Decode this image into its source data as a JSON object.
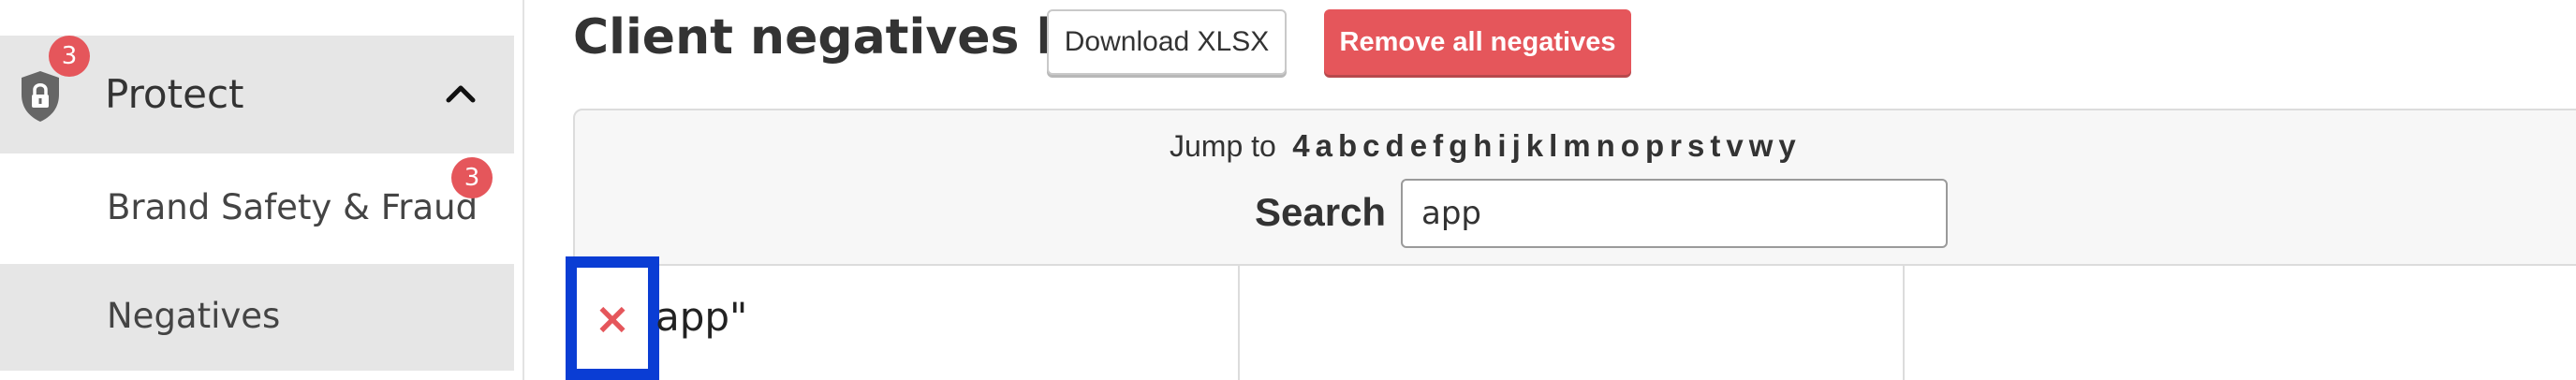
{
  "sidebar": {
    "protect": {
      "label": "Protect",
      "badge": "3",
      "icon": "shield-lock-icon",
      "chevron": "chevron-up-icon"
    },
    "brand_safety": {
      "label": "Brand Safety & Fraud",
      "badge": "3"
    },
    "negatives": {
      "label": "Negatives"
    }
  },
  "main": {
    "title": "Client negatives list",
    "download_label": "Download XLSX",
    "remove_all_label": "Remove all negatives",
    "jump_label": "Jump to",
    "letters": [
      "4",
      "a",
      "b",
      "c",
      "d",
      "e",
      "f",
      "g",
      "h",
      "i",
      "j",
      "k",
      "l",
      "m",
      "n",
      "o",
      "p",
      "r",
      "s",
      "t",
      "v",
      "w",
      "y"
    ],
    "search_label": "Search",
    "search_value": "app",
    "rows": [
      {
        "remove_glyph": "×",
        "text": "app\""
      }
    ]
  },
  "colors": {
    "accent_red": "#e5565b",
    "highlight_blue": "#0a3dd4",
    "sidebar_active": "#e6e6e6"
  }
}
